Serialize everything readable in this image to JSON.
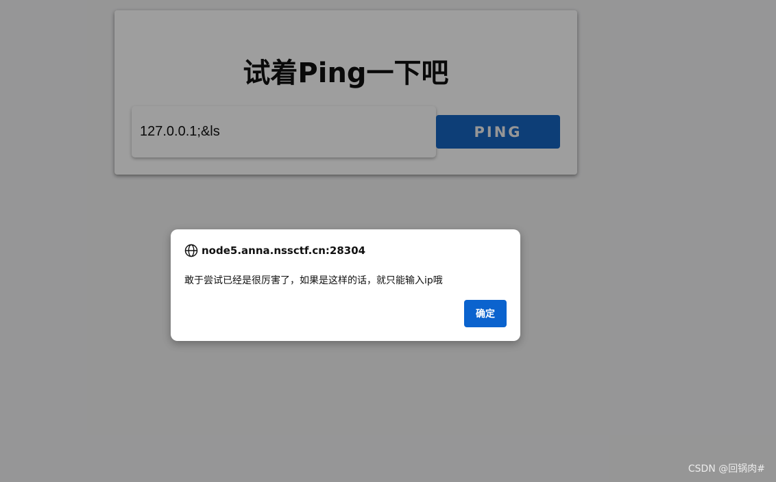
{
  "page": {
    "title": "试着Ping一下吧",
    "input_value": "127.0.0.1;&ls",
    "button_label": "PING"
  },
  "dialog": {
    "origin": "node5.anna.nssctf.cn:28304",
    "icon": "globe-icon",
    "message": "敢于尝试已经是很厉害了，如果是这样的话，就只能输入ip哦",
    "ok_label": "确定"
  },
  "watermark": {
    "text": "CSDN @回锅肉#"
  },
  "colors": {
    "accent": "#1565c0",
    "dialog_button": "#0b63ce"
  }
}
